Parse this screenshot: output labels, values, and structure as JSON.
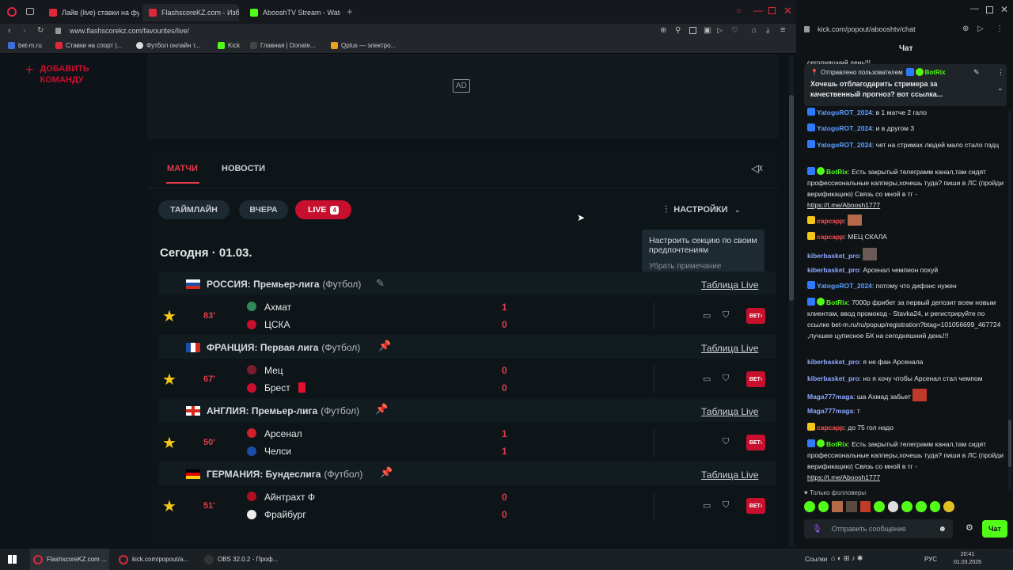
{
  "browser_left": {
    "tabs": [
      {
        "label": "Лайв (live) ставки на фут"
      },
      {
        "label": "FlashscoreKZ.com - Избр"
      },
      {
        "label": "AbooshTV Stream - Watch"
      }
    ],
    "url": "www.flashscorekz.com/favourites/live/",
    "bookmarks": [
      "bet-m.ru",
      "Ставки на спорт |...",
      "Футбол онлайн т...",
      "Kick",
      "Главная | Donate...",
      "Qplus — электро..."
    ]
  },
  "page": {
    "add_team": "ДОБАВИТЬ КОМАНДУ",
    "ad_label": "AD",
    "tabs": {
      "matches": "МАТЧИ",
      "news": "НОВОСТИ"
    },
    "filters": {
      "timeline": "ТАЙМЛАЙН",
      "yesterday": "ВЧЕРА",
      "live": "LIVE",
      "live_count": "4"
    },
    "settings": "НАСТРОЙКИ",
    "tooltip": {
      "text": "Настроить секцию по своим предпочтениям",
      "dismiss": "Убрать примечание"
    },
    "date_heading": "Сегодня · 01.03.",
    "table_live": "Таблица Live",
    "bet_label": "BET",
    "leagues": [
      {
        "name": "РОССИЯ: Премьер-лига",
        "sport": "(Футбол)",
        "minute": "83'",
        "home": "Ахмат",
        "away": "ЦСКА",
        "home_score": "1",
        "away_score": "0"
      },
      {
        "name": "ФРАНЦИЯ: Первая лига",
        "sport": "(Футбол)",
        "minute": "67'",
        "home": "Мец",
        "away": "Брест",
        "home_score": "0",
        "away_score": "0"
      },
      {
        "name": "АНГЛИЯ: Премьер-лига",
        "sport": "(Футбол)",
        "minute": "50'",
        "home": "Арсенал",
        "away": "Челси",
        "home_score": "1",
        "away_score": "1"
      },
      {
        "name": "ГЕРМАНИЯ: Бундеслига",
        "sport": "(Футбол)",
        "minute": "51'",
        "home": "Айнтрахт Ф",
        "away": "Фрайбург",
        "home_score": "0",
        "away_score": "0"
      }
    ]
  },
  "browser_right": {
    "url": "kick.com/popout/abooshtv/chat",
    "chat_title": "Чат",
    "pinned_header": "Отправлено пользователем",
    "pinned_user": "BotRix",
    "pinned_text": "Хочешь отблагодарить стримера за качественный прогноз? вот ссылка...",
    "top_cut": "сегодняшний день!!!",
    "messages": [
      {
        "user": "YatogoROT_2024",
        "text": "в 1 матче 2 гало",
        "color": "#5ea0ff"
      },
      {
        "user": "YatogoROT_2024",
        "text": "и в другом 3",
        "color": "#5ea0ff"
      },
      {
        "user": "YatogoROT_2024",
        "text": "чет на стримах людей мало стало пздц",
        "color": "#5ea0ff"
      },
      {
        "user": "BotRix",
        "text": "Есть закрытый телеграмм канал,там сидят профессиональные капперы,хочешь туда? пиши в ЛС (пройди верификацию) Связь со мной в тг -",
        "link": "https://t.me/Aboosh1777",
        "color": "#53fc18"
      },
      {
        "user": "capcapp",
        "text": "",
        "color": "#ff5050"
      },
      {
        "user": "capcapp",
        "text": "МЕЦ СКАЛА",
        "color": "#ff5050"
      },
      {
        "user": "kiberbasket_pro",
        "text": "",
        "color": "#8ea8ff"
      },
      {
        "user": "kiberbasket_pro",
        "text": "Арсенал чемпион похуй",
        "color": "#8ea8ff"
      },
      {
        "user": "YatogoROT_2024",
        "text": "потому что дифэнс нужен",
        "color": "#5ea0ff"
      },
      {
        "user": "BotRix",
        "text": "7000р фрибет за первый депозит всем новым клиентам, ввод промокод - Stavka24, и регистрируйте по ссылке bet-m.ru/ru/popup/registration?btag=101056699_467724 ,лучшее цуписное БК на сегодняшний день!!!",
        "color": "#53fc18"
      },
      {
        "user": "kiberbasket_pro",
        "text": "я не фан Арсенала",
        "color": "#8ea8ff"
      },
      {
        "user": "kiberbasket_pro",
        "text": "но я хочу чтобы Арсенал стал чемпом",
        "color": "#8ea8ff"
      },
      {
        "user": "Maga777maga",
        "text": "ша Ахмад забьет",
        "color": "#8ea8ff"
      },
      {
        "user": "Maga777maga",
        "text": "т",
        "color": "#8ea8ff"
      },
      {
        "user": "capcapp",
        "text": "до 75 гол надо",
        "color": "#ff5050"
      },
      {
        "user": "BotRix",
        "text": "Есть закрытый телеграмм канал,там сидят профессиональные капперы,хочешь туда? пиши в ЛС (пройди верификацию) Связь со мной в тг -",
        "link": "https://t.me/Aboosh1777",
        "color": "#53fc18"
      }
    ],
    "followers_only": "Только фолловеры",
    "input_placeholder": "Отправить сообщение",
    "send_label": "Чат"
  },
  "taskbar": {
    "items": [
      "FlashscoreKZ.com ...",
      "kick.com/popout/a...",
      "OBS 32.0.2 - Проф..."
    ],
    "links": "Ссылки",
    "lang": "РУС",
    "time": "20:41",
    "date": "01.03.2026"
  }
}
